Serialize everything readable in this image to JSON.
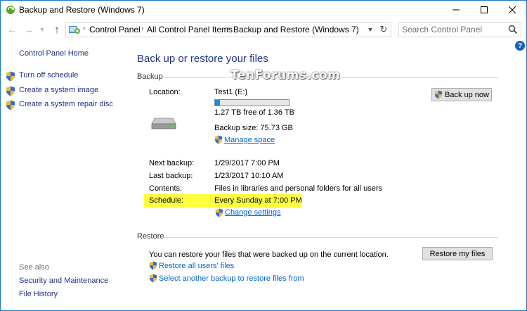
{
  "window": {
    "title": "Backup and Restore (Windows 7)"
  },
  "address": {
    "breadcrumbs": [
      "Control Panel",
      "All Control Panel Items",
      "Backup and Restore (Windows 7)"
    ],
    "search_placeholder": "Search Control Panel"
  },
  "sidebar": {
    "home": "Control Panel Home",
    "tasks": [
      "Turn off schedule",
      "Create a system image",
      "Create a system repair disc"
    ],
    "see_also_label": "See also",
    "see_also": [
      "Security and Maintenance",
      "File History"
    ]
  },
  "main": {
    "title": "Back up or restore your files",
    "watermark": "TenForums.com",
    "backup": {
      "section": "Backup",
      "location_label": "Location:",
      "location_value": "Test1 (E:)",
      "usage_fraction": 0.066,
      "free_text": "1.27 TB free of 1.36 TB",
      "backup_size": "Backup size: 75.73 GB",
      "manage_space": "Manage space",
      "backup_now": "Back up now",
      "next_label": "Next backup:",
      "next_value": "1/29/2017 7:00 PM",
      "last_label": "Last backup:",
      "last_value": "1/23/2017 10:10 AM",
      "contents_label": "Contents:",
      "contents_value": "Files in libraries and personal folders for all users",
      "schedule_label": "Schedule:",
      "schedule_value": "Every Sunday at 7:00 PM",
      "change_settings": "Change settings"
    },
    "restore": {
      "section": "Restore",
      "description": "You can restore your files that were backed up on the current location.",
      "restore_my_files": "Restore my files",
      "restore_all_users": "Restore all users' files",
      "select_another": "Select another backup to restore files from"
    }
  },
  "colors": {
    "link": "#0066cc",
    "heading": "#1e3287",
    "highlight": "#ffff3c",
    "progress": "#1c8cdc"
  }
}
